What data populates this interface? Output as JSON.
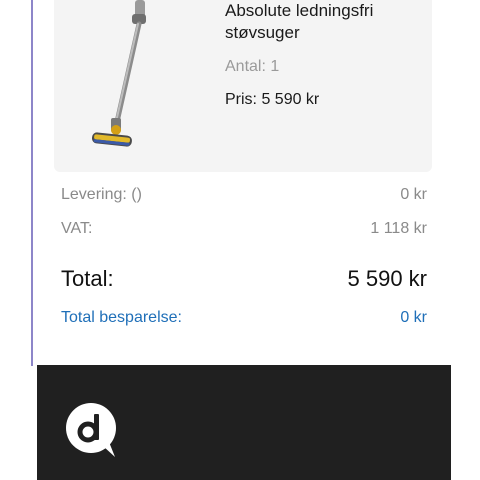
{
  "product": {
    "name": "Absolute ledningsfri støvsuger",
    "quantity": "Antal: 1",
    "price": "Pris: 5 590 kr"
  },
  "summary": {
    "delivery_label": "Levering: ()",
    "delivery_value": "0 kr",
    "vat_label": "VAT:",
    "vat_value": "1 118 kr",
    "total_label": "Total:",
    "total_value": "5 590 kr",
    "savings_label": "Total besparelse:",
    "savings_value": "0 kr"
  },
  "colors": {
    "accent_blue": "#1f6fb8",
    "footer_bg": "#202020",
    "card_bg": "#f4f4f4",
    "muted_text": "#8a8a8a"
  },
  "icons": {
    "footer_logo": "d-speech-bubble-logo"
  }
}
